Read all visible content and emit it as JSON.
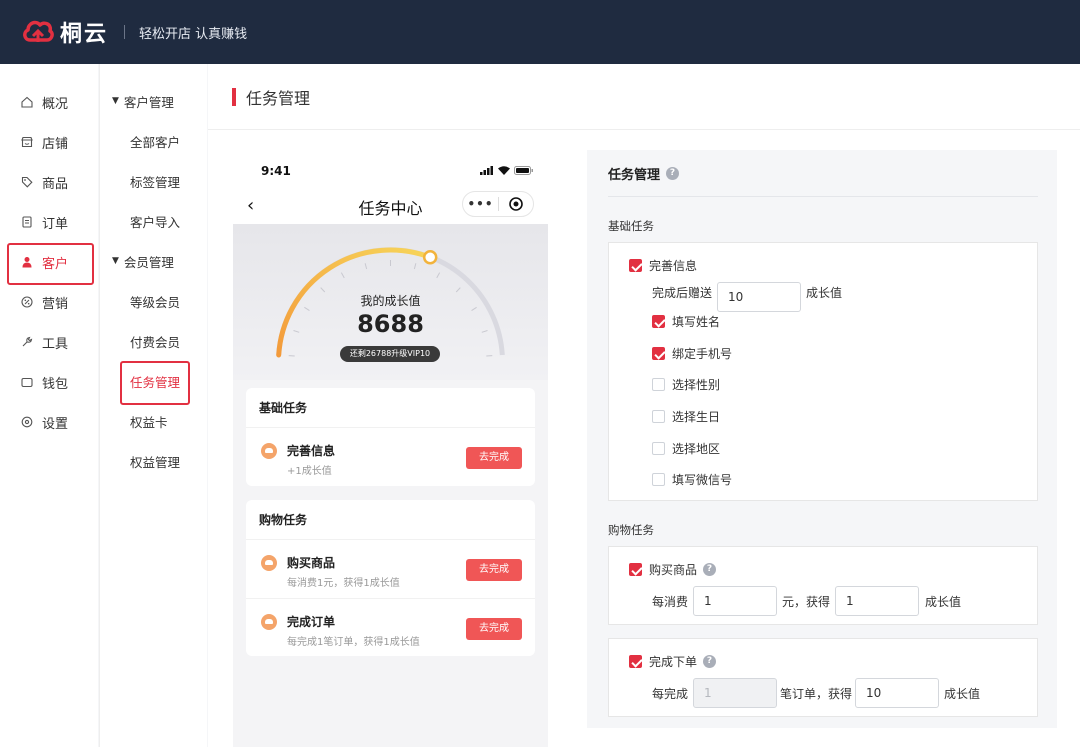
{
  "header": {
    "brand": "桐云",
    "slogan": "轻松开店 认真赚钱"
  },
  "nav1": [
    {
      "label": "概况",
      "icon": "home-icon"
    },
    {
      "label": "店铺",
      "icon": "store-icon"
    },
    {
      "label": "商品",
      "icon": "tag-icon"
    },
    {
      "label": "订单",
      "icon": "order-icon"
    },
    {
      "label": "客户",
      "icon": "user-icon",
      "active": true
    },
    {
      "label": "营销",
      "icon": "marketing-icon"
    },
    {
      "label": "工具",
      "icon": "tool-icon"
    },
    {
      "label": "钱包",
      "icon": "wallet-icon"
    },
    {
      "label": "设置",
      "icon": "settings-icon"
    }
  ],
  "nav2": {
    "group1": "客户管理",
    "group1_items": [
      "全部客户",
      "标签管理",
      "客户导入"
    ],
    "group2": "会员管理",
    "group2_items": [
      "等级会员",
      "付费会员",
      "任务管理",
      "权益卡",
      "权益管理"
    ]
  },
  "page": {
    "title": "任务管理"
  },
  "phone": {
    "time": "9:41",
    "title": "任务中心",
    "back": "‹",
    "gauge_label": "我的成长值",
    "gauge_value": "8688",
    "gauge_badge": "还剩26788升级VIP10",
    "gauge_progress": 0.62,
    "basic_section": "基础任务",
    "shop_section": "购物任务",
    "tasks_basic": [
      {
        "title": "完善信息",
        "desc": "+1成长值",
        "button": "去完成"
      }
    ],
    "tasks_shop": [
      {
        "title": "购买商品",
        "desc": "每消费1元，获得1成长值",
        "button": "去完成"
      },
      {
        "title": "完成订单",
        "desc": "每完成1笔订单，获得1成长值",
        "button": "去完成"
      }
    ]
  },
  "settings": {
    "title": "任务管理",
    "help": "?",
    "basic_label": "基础任务",
    "info_task": {
      "label": "完善信息",
      "checked": true
    },
    "reward_prefix": "完成后赠送",
    "reward_value": "10",
    "reward_suffix": "成长值",
    "sub_options": [
      {
        "label": "填写姓名",
        "checked": true
      },
      {
        "label": "绑定手机号",
        "checked": true
      },
      {
        "label": "选择性别",
        "checked": false
      },
      {
        "label": "选择生日",
        "checked": false
      },
      {
        "label": "选择地区",
        "checked": false
      },
      {
        "label": "填写微信号",
        "checked": false
      }
    ],
    "shop_label": "购物任务",
    "buy_task": {
      "label": "购买商品",
      "checked": true,
      "prefix": "每消费",
      "value1": "1",
      "middle": "元，获得",
      "value2": "1",
      "suffix": "成长值"
    },
    "order_task": {
      "label": "完成下单",
      "checked": true,
      "prefix": "每完成",
      "value1": "1",
      "middle": "笔订单，获得",
      "value2": "10",
      "suffix": "成长值"
    }
  },
  "colors": {
    "accent": "#e23041",
    "topbar": "#1f2b40",
    "task_button": "#f05656"
  }
}
